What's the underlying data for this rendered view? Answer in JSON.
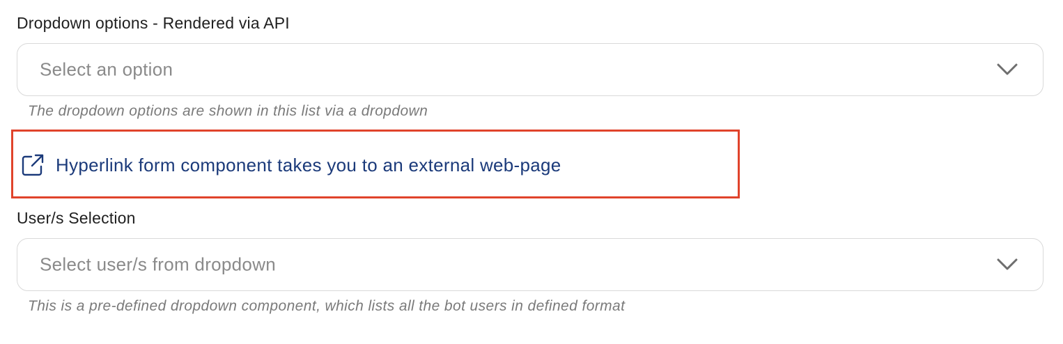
{
  "dropdown_api": {
    "label": "Dropdown options - Rendered via API",
    "placeholder": "Select an option",
    "helper": "The dropdown options are shown in this list via a dropdown"
  },
  "hyperlink": {
    "text": "Hyperlink form component takes you to an external web-page",
    "icon": "external-link-icon",
    "color": "#1b3a7a",
    "highlight_color": "#e0432b"
  },
  "user_selection": {
    "label": "User/s Selection",
    "placeholder": "Select user/s from dropdown",
    "helper": "This is a pre-defined dropdown component, which lists all the bot users in defined format"
  }
}
